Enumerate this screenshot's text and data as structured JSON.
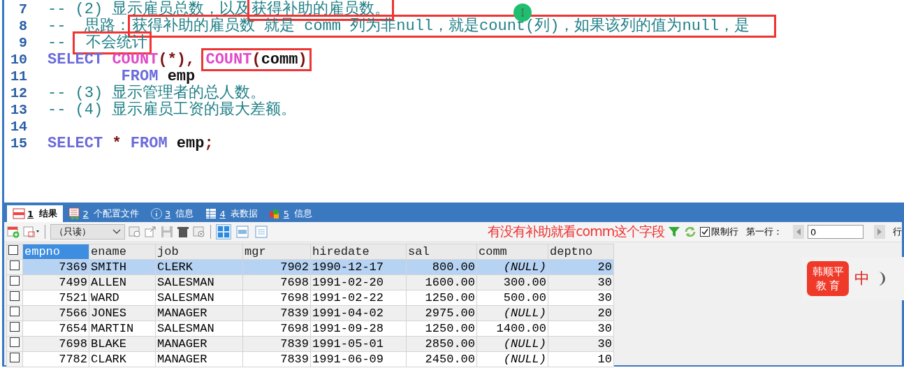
{
  "editor": {
    "lines": [
      {
        "number": "7",
        "tokens": [
          {
            "kind": "comment",
            "text": "-- (2) 显示雇员总数，以及"
          },
          {
            "kind": "comment",
            "text": "获得补助的雇员数。",
            "boxed": true
          }
        ]
      },
      {
        "number": "8",
        "tokens": [
          {
            "kind": "comment",
            "text": "--  思路："
          },
          {
            "kind": "comment",
            "text": "获得补助的雇员数 就是 comm 列为非null，就是count(列)，如果该列的值为null，是",
            "boxed": true
          }
        ]
      },
      {
        "number": "9",
        "tokens": [
          {
            "kind": "comment",
            "text": "-- "
          },
          {
            "kind": "comment",
            "text": " 不会统计",
            "boxed": true
          }
        ]
      },
      {
        "number": "10",
        "tokens": [
          {
            "kind": "keyword",
            "text": "SELECT "
          },
          {
            "kind": "function",
            "text": "COUNT"
          },
          {
            "kind": "punct",
            "text": "(*), "
          },
          {
            "kind": "call",
            "boxed": true,
            "parts": [
              {
                "kind": "function",
                "text": "COUNT"
              },
              {
                "kind": "punct",
                "text": "("
              },
              {
                "kind": "ident",
                "text": "comm"
              },
              {
                "kind": "punct",
                "text": ")"
              }
            ]
          }
        ]
      },
      {
        "number": "11",
        "indented": true,
        "tokens": [
          {
            "kind": "keyword",
            "text": "FROM "
          },
          {
            "kind": "ident",
            "text": "emp"
          }
        ]
      },
      {
        "number": "12",
        "tokens": [
          {
            "kind": "comment",
            "text": "-- (3) 显示管理者的总人数。"
          }
        ]
      },
      {
        "number": "13",
        "tokens": [
          {
            "kind": "comment",
            "text": "-- (4) 显示雇员工资的最大差额。"
          }
        ]
      },
      {
        "number": "14"
      },
      {
        "number": "15",
        "tokens": [
          {
            "kind": "keyword",
            "text": "SELECT "
          },
          {
            "kind": "punct",
            "text": "* "
          },
          {
            "kind": "keyword",
            "text": "FROM "
          },
          {
            "kind": "ident",
            "text": "emp"
          },
          {
            "kind": "punct",
            "text": ";"
          }
        ]
      }
    ]
  },
  "result_panel": {
    "tabs": [
      {
        "num": "1",
        "label": " 结果",
        "kind": "result",
        "selected": true
      },
      {
        "num": "2",
        "label": " 个配置文件",
        "kind": "profile",
        "selected": false
      },
      {
        "num": "3",
        "label": " 信息",
        "kind": "info",
        "selected": false
      },
      {
        "num": "4",
        "label": " 表数据",
        "kind": "table",
        "selected": false
      },
      {
        "num": "5",
        "label": " 信息",
        "kind": "blocks",
        "selected": false
      }
    ],
    "toolbar": {
      "mode_select": "（只读）",
      "view_buttons": [
        {
          "selected": true
        },
        {
          "selected": false
        },
        {
          "selected": false
        }
      ],
      "note": "有没有补助就看comm这个字段",
      "limit_rows": {
        "label": "限制行",
        "checked": true
      },
      "first_row_label": "第一行：",
      "first_row_value": "0",
      "rows_label": "行"
    },
    "table": {
      "all_checked": false,
      "columns": [
        {
          "label": "empno",
          "kind": "number",
          "selected": true
        },
        {
          "label": "ename",
          "kind": "text",
          "selected": false
        },
        {
          "label": "job",
          "kind": "text",
          "selected": false
        },
        {
          "label": "mgr",
          "kind": "number",
          "selected": false
        },
        {
          "label": "hiredate",
          "kind": "text",
          "selected": false
        },
        {
          "label": "sal",
          "kind": "number",
          "selected": false
        },
        {
          "label": "comm",
          "kind": "number",
          "selected": false
        },
        {
          "label": "deptno",
          "kind": "number",
          "selected": false
        }
      ],
      "rows": [
        {
          "checked": false,
          "selected": true,
          "cells": [
            "7369",
            "SMITH",
            "CLERK",
            "7902",
            "1990-12-17",
            "800.00",
            {
              "kind": "null",
              "text": "(NULL)"
            },
            "20"
          ]
        },
        {
          "checked": false,
          "selected": false,
          "cells": [
            "7499",
            "ALLEN",
            "SALESMAN",
            "7698",
            "1991-02-20",
            "1600.00",
            "300.00",
            "30"
          ]
        },
        {
          "checked": false,
          "selected": false,
          "cells": [
            "7521",
            "WARD",
            "SALESMAN",
            "7698",
            "1991-02-22",
            "1250.00",
            "500.00",
            "30"
          ]
        },
        {
          "checked": false,
          "selected": false,
          "cells": [
            "7566",
            "JONES",
            "MANAGER",
            "7839",
            "1991-04-02",
            "2975.00",
            {
              "kind": "null",
              "text": "(NULL)"
            },
            "20"
          ]
        },
        {
          "checked": false,
          "selected": false,
          "cells": [
            "7654",
            "MARTIN",
            "SALESMAN",
            "7698",
            "1991-09-28",
            "1250.00",
            "1400.00",
            "30"
          ]
        },
        {
          "checked": false,
          "selected": false,
          "cells": [
            "7698",
            "BLAKE",
            "MANAGER",
            "7839",
            "1991-05-01",
            "2850.00",
            {
              "kind": "null",
              "text": "(NULL)"
            },
            "30"
          ]
        },
        {
          "checked": false,
          "selected": false,
          "cells": [
            "7782",
            "CLARK",
            "MANAGER",
            "7839",
            "1991-06-09",
            "2450.00",
            {
              "kind": "null",
              "text": "(NULL)"
            },
            "10"
          ]
        }
      ]
    }
  },
  "overlay": {
    "logo_line1": "韩顺平",
    "logo_line2": "教 育",
    "ime_mode": "中"
  }
}
